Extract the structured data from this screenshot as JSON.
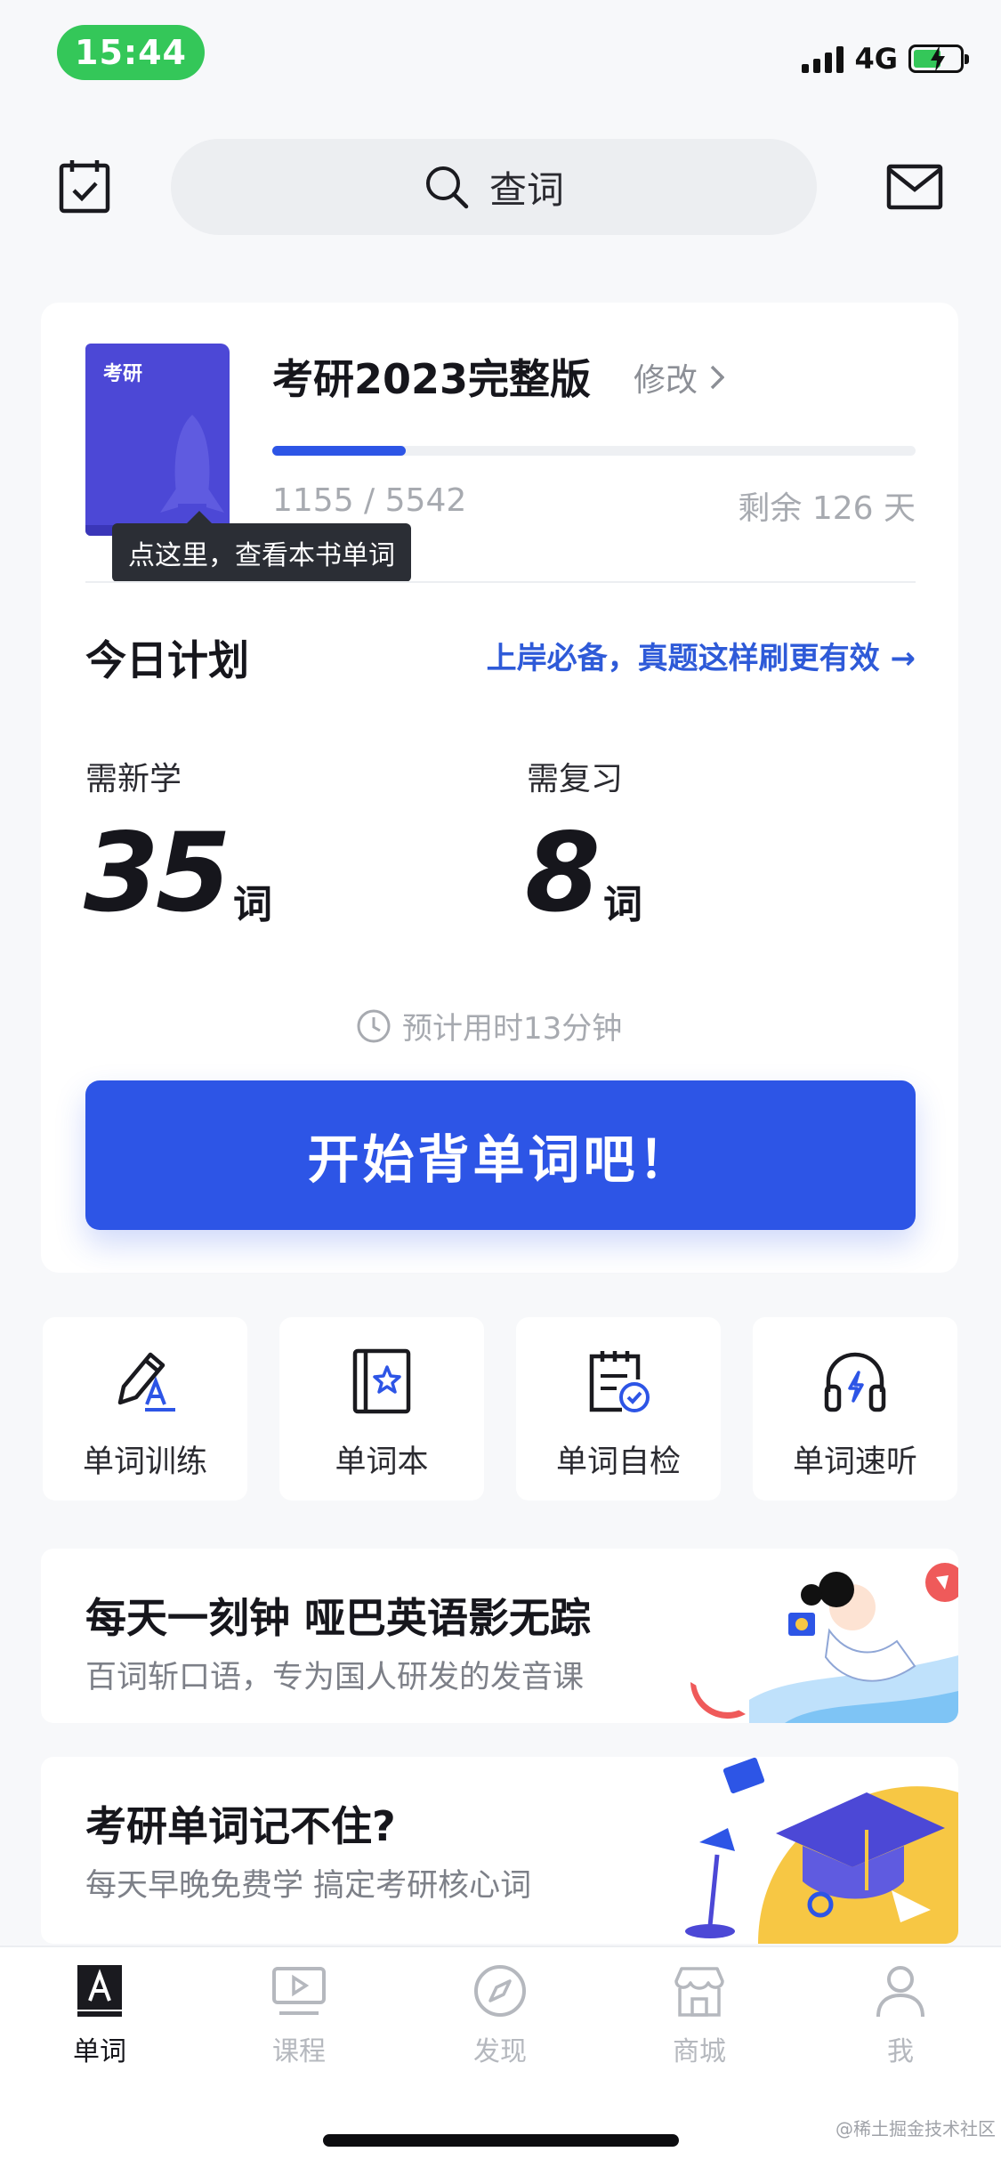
{
  "status_bar": {
    "time": "15:44",
    "network": "4G",
    "battery_level": 0.6
  },
  "header": {
    "search_placeholder": "查词"
  },
  "book": {
    "cover_label": "考研",
    "title": "考研2023完整版",
    "modify_label": "修改",
    "progress_text": "1155 / 5542",
    "progress_fraction": 0.208,
    "days_left": "剩余 126 天",
    "tooltip": "点这里，查看本书单词"
  },
  "plan": {
    "title": "今日计划",
    "link": "上岸必备，真题这样刷更有效 →",
    "new_label": "需新学",
    "new_count": "35",
    "new_unit": "词",
    "review_label": "需复习",
    "review_count": "8",
    "review_unit": "词",
    "estimate": "预计用时13分钟",
    "start_button": "开始背单词吧！"
  },
  "features": [
    {
      "label": "单词训练",
      "icon": "pencil-icon"
    },
    {
      "label": "单词本",
      "icon": "star-book-icon"
    },
    {
      "label": "单词自检",
      "icon": "checklist-icon"
    },
    {
      "label": "单词速听",
      "icon": "headphones-icon"
    }
  ],
  "banners": [
    {
      "title": "每天一刻钟 哑巴英语影无踪",
      "subtitle": "百词斩口语，专为国人研发的发音课"
    },
    {
      "title": "考研单词记不住?",
      "subtitle": "每天早晚免费学  搞定考研核心词"
    }
  ],
  "tabs": [
    {
      "label": "单词",
      "icon": "word-icon",
      "active": true
    },
    {
      "label": "课程",
      "icon": "video-icon",
      "active": false
    },
    {
      "label": "发现",
      "icon": "compass-icon",
      "active": false
    },
    {
      "label": "商城",
      "icon": "store-icon",
      "active": false
    },
    {
      "label": "我",
      "icon": "profile-icon",
      "active": false
    }
  ],
  "watermark": "@稀土掘金技术社区",
  "colors": {
    "primary": "#2d55e6",
    "link": "#2e5ad8",
    "book_cover": "#4c48d6",
    "status_green": "#34c759"
  }
}
